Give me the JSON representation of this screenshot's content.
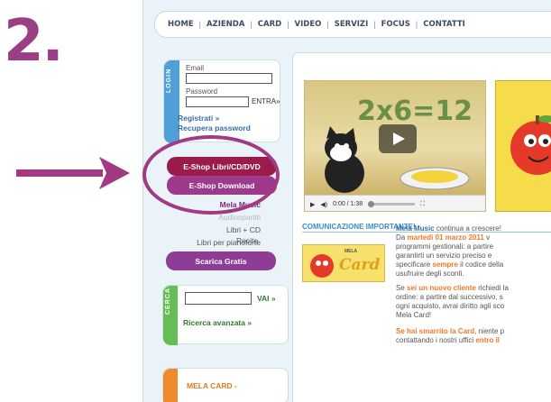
{
  "step_number": "2.",
  "site": {
    "nav": [
      "HOME",
      "AZIENDA",
      "CARD",
      "VIDEO",
      "SERVIZI",
      "FOCUS",
      "CONTATTI"
    ],
    "login": {
      "tab_label": "LOGIN",
      "email_label": "Email",
      "password_label": "Password",
      "enter_label": "ENTRA»",
      "register_line1": "Registrati »",
      "register_line2": "Recupera password"
    },
    "menu": {
      "eshop": "E-Shop Libri/CD/DVD",
      "download": "E-Shop Download",
      "mela_music": "Mela Music",
      "audio": "Audiospartiti",
      "libri_cd": "Libri + CD",
      "piano": "Libri per pianoforte",
      "recite": "Recite",
      "scarica": "Scarica Gratis"
    },
    "search": {
      "tab_label": "CERCA",
      "go_label": "VAI »",
      "advanced": "Ricerca avanzata »"
    },
    "mela_card_box": "MELA CARD -",
    "video": {
      "title": "2x6=12",
      "time": "0:00 / 1:38"
    },
    "announcement": {
      "title": "COMUNICAZIONE IMPORTANTE!",
      "card_brand": "MELA",
      "card_word": "Card",
      "p1_a": "Mela Music",
      "p1_b": " continua a crescere!",
      "p1_c": "Da ",
      "p1_date": "martedì 01 marzo 2011",
      "p1_d": " v",
      "p1_e": "programmi gestionali: a partire",
      "p1_f": "garantirti un servizio preciso e",
      "p1_g": "specificare ",
      "p1_sempre": "sempre",
      "p1_h": " il codice della",
      "p1_i": "usufruire degli sconti.",
      "p2_a": "Se ",
      "p2_b": "sei un nuovo cliente",
      "p2_c": " richiedi la",
      "p2_d": "ordine: a partire dal successivo, s",
      "p2_e": "ogni acquisto, avrai diritto agli sco",
      "p2_f": "Mela Card!",
      "p3_a": "Se hai smarrito la Card",
      "p3_b": ", niente p",
      "p3_c": "contattando i nostri uffici ",
      "p3_d": "entro il"
    }
  },
  "colors": {
    "accent_purple": "#9b1b4b",
    "highlight_ring": "#a13983",
    "step_purple": "#9a3f86"
  }
}
